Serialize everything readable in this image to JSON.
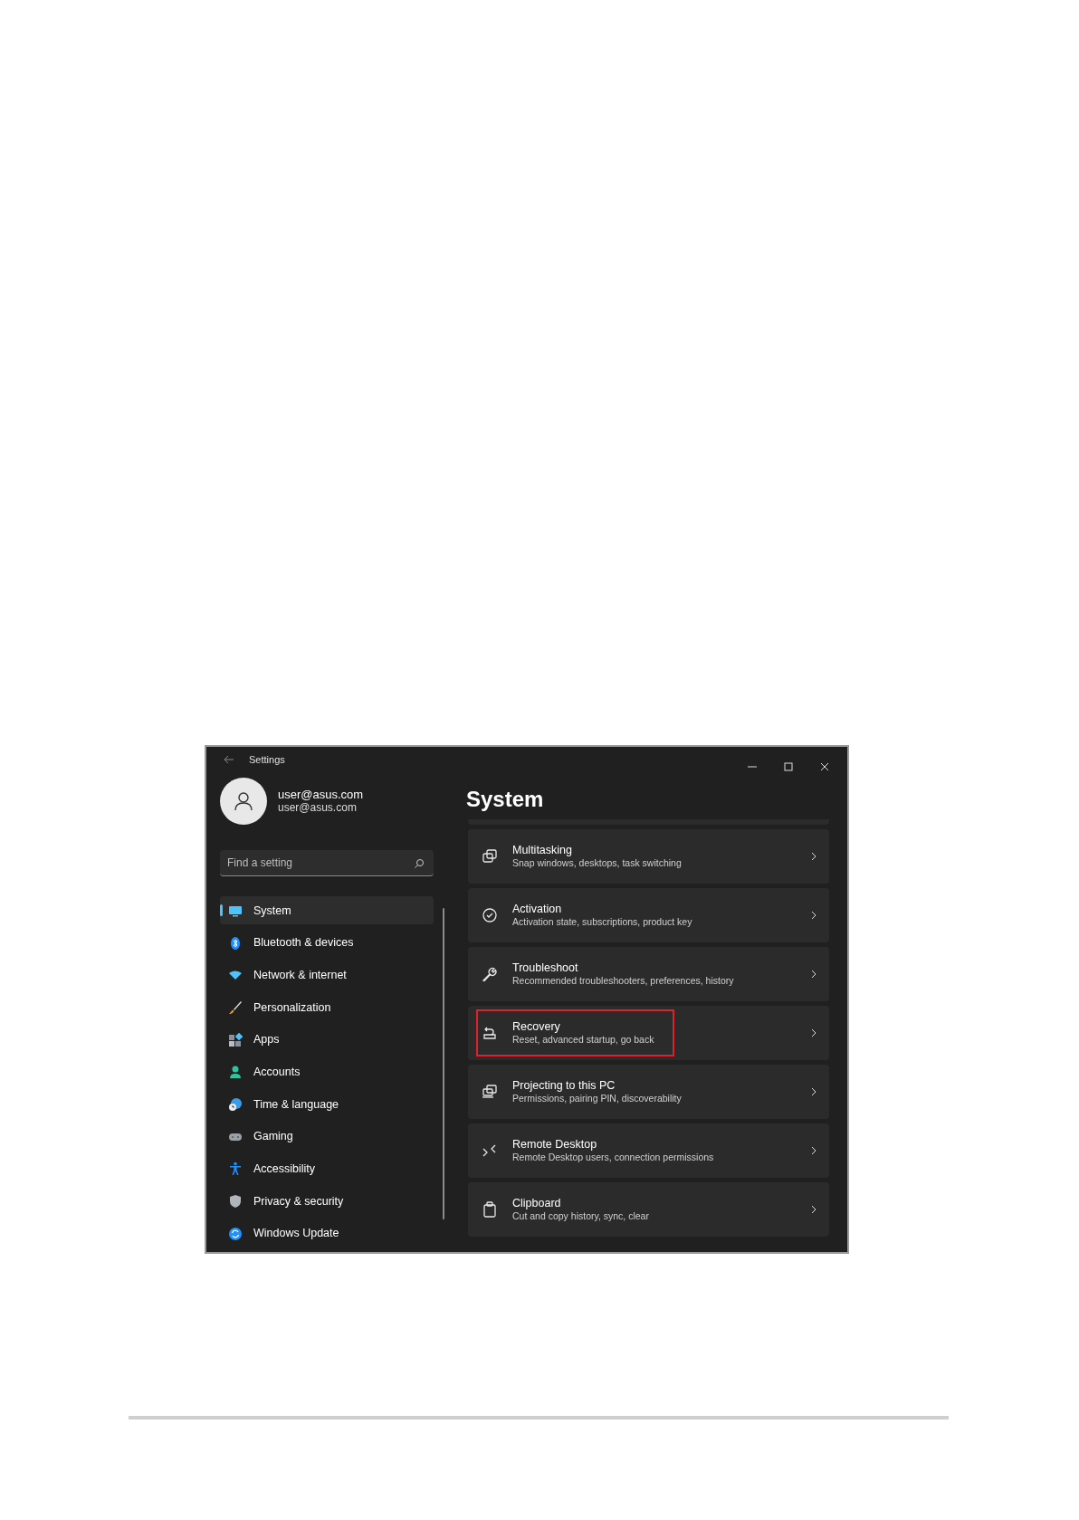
{
  "window": {
    "title": "Settings"
  },
  "account": {
    "name": "user@asus.com",
    "email": "user@asus.com"
  },
  "search": {
    "placeholder": "Find a setting"
  },
  "nav": [
    {
      "label": "System",
      "selected": true
    },
    {
      "label": "Bluetooth & devices",
      "selected": false
    },
    {
      "label": "Network & internet",
      "selected": false
    },
    {
      "label": "Personalization",
      "selected": false
    },
    {
      "label": "Apps",
      "selected": false
    },
    {
      "label": "Accounts",
      "selected": false
    },
    {
      "label": "Time & language",
      "selected": false
    },
    {
      "label": "Gaming",
      "selected": false
    },
    {
      "label": "Accessibility",
      "selected": false
    },
    {
      "label": "Privacy & security",
      "selected": false
    },
    {
      "label": "Windows Update",
      "selected": false
    }
  ],
  "page": {
    "title": "System"
  },
  "cards": [
    {
      "title": "Multitasking",
      "subtitle": "Snap windows, desktops, task switching",
      "highlighted": false
    },
    {
      "title": "Activation",
      "subtitle": "Activation state, subscriptions, product key",
      "highlighted": false
    },
    {
      "title": "Troubleshoot",
      "subtitle": "Recommended troubleshooters, preferences, history",
      "highlighted": false
    },
    {
      "title": "Recovery",
      "subtitle": "Reset, advanced startup, go back",
      "highlighted": true
    },
    {
      "title": "Projecting to this PC",
      "subtitle": "Permissions, pairing PIN, discoverability",
      "highlighted": false
    },
    {
      "title": "Remote Desktop",
      "subtitle": "Remote Desktop users, connection permissions",
      "highlighted": false
    },
    {
      "title": "Clipboard",
      "subtitle": "Cut and copy history, sync, clear",
      "highlighted": false
    }
  ]
}
